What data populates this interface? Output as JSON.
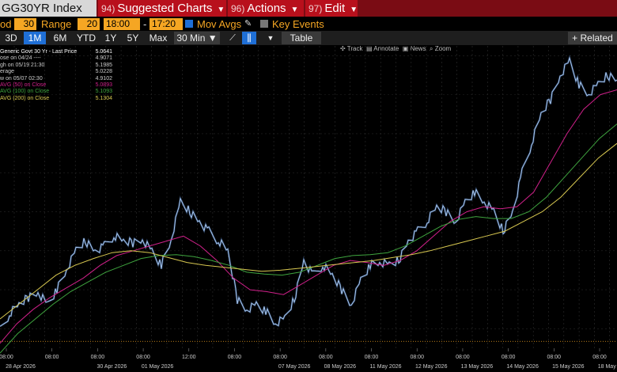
{
  "header": {
    "ticker": "GG30YR Index",
    "menus": [
      {
        "num": "94)",
        "label": "Suggested Charts"
      },
      {
        "num": "96)",
        "label": "Actions"
      },
      {
        "num": "97)",
        "label": "Edit"
      }
    ]
  },
  "settings": {
    "period_label": "od",
    "period_value": "30",
    "range_label": "Range",
    "range_value": "20",
    "time_start": "18:00",
    "time_sep": "-",
    "time_end": "17:20",
    "mov_avgs": "Mov Avgs",
    "key_events": "Key Events"
  },
  "toolbar": {
    "ranges": [
      "3D",
      "1M",
      "6M",
      "YTD",
      "1Y",
      "5Y",
      "Max"
    ],
    "active_range": "1M",
    "interval": "30 Min ▼",
    "table": "Table",
    "related": "+ Related"
  },
  "tools": {
    "track": "Track",
    "annotate": "Annotate",
    "news": "News",
    "zoom": "Zoom"
  },
  "legend": [
    {
      "label": "Generic Govt 30 Yr - Last Price",
      "value": "5.0641",
      "color": "#ffffff"
    },
    {
      "label": "ose on 04/24 ----",
      "value": "4.9071",
      "color": "#cccccc"
    },
    {
      "label": "gh on 05/19 21:30",
      "value": "5.1985",
      "color": "#cccccc"
    },
    {
      "label": "erage",
      "value": "5.0228",
      "color": "#cccccc"
    },
    {
      "label": "w on 05/07 02:30",
      "value": "4.9102",
      "color": "#cccccc"
    },
    {
      "label": "AVG (50)  on Close",
      "value": "5.0893",
      "color": "#d0208a"
    },
    {
      "label": "AVG (100)  on Close",
      "value": "5.1093",
      "color": "#3fa53f"
    },
    {
      "label": "AVG (200)  on Close",
      "value": "5.1304",
      "color": "#d8c850"
    }
  ],
  "colors": {
    "price": "#a8c8f0",
    "ma50": "#d0208a",
    "ma100": "#3fa53f",
    "ma200": "#d8c850",
    "avg_line": "#f5a623",
    "accent": "#1f6fd6",
    "header_bg": "#b8101c"
  },
  "chart_data": {
    "type": "line",
    "ylim": [
      4.9,
      5.21
    ],
    "average": 5.0228,
    "close_ref": 4.9071,
    "x_ticks": [
      {
        "time": "08:00",
        "date": "28 Apr 2026"
      },
      {
        "time": "08:00",
        "date": ""
      },
      {
        "time": "08:00",
        "date": "30 Apr 2026"
      },
      {
        "time": "08:00",
        "date": "01 May 2026"
      },
      {
        "time": "12:00",
        "date": ""
      },
      {
        "time": "08:00",
        "date": ""
      },
      {
        "time": "08:00",
        "date": "07 May 2026"
      },
      {
        "time": "08:00",
        "date": "08 May 2026"
      },
      {
        "time": "08:00",
        "date": "11 May 2026"
      },
      {
        "time": "08:00",
        "date": "12 May 2026"
      },
      {
        "time": "08:00",
        "date": "13 May 2026"
      },
      {
        "time": "08:00",
        "date": "14 May 2026"
      },
      {
        "time": "08:00",
        "date": "15 May 2026"
      },
      {
        "time": "08:00",
        "date": "18 May 2026"
      }
    ],
    "series": [
      {
        "name": "Generic Govt 30 Yr - Last Price",
        "role": "price",
        "values": [
          4.918,
          4.935,
          4.945,
          4.952,
          4.958,
          4.945,
          4.96,
          4.98,
          5.0,
          5.01,
          5.0,
          5.005,
          5.015,
          5.01,
          5.008,
          5.012,
          5.0,
          4.985,
          5.01,
          5.05,
          5.04,
          5.03,
          5.02,
          5.01,
          5.0,
          4.95,
          4.94,
          4.945,
          4.938,
          4.925,
          4.93,
          4.95,
          4.99,
          4.975,
          4.985,
          4.975,
          4.96,
          4.945,
          4.97,
          4.985,
          4.988,
          4.985,
          4.99,
          5.01,
          5.02,
          5.03,
          5.045,
          5.04,
          5.03,
          5.05,
          5.06,
          5.05,
          5.04,
          5.02,
          5.04,
          5.08,
          5.11,
          5.14,
          5.155,
          5.18,
          5.195,
          5.17,
          5.16,
          5.17,
          5.18,
          5.175
        ]
      },
      {
        "name": "AVG (50)  on Close",
        "role": "ma50",
        "values": [
          4.905,
          4.925,
          4.94,
          4.952,
          4.962,
          4.972,
          4.985,
          4.995,
          5.0,
          5.005,
          5.01,
          5.015,
          5.005,
          4.99,
          4.972,
          4.96,
          4.958,
          4.955,
          4.965,
          4.975,
          4.985,
          4.99,
          4.988,
          4.985,
          4.99,
          5.0,
          5.015,
          5.03,
          5.04,
          5.045,
          5.043,
          5.045,
          5.06,
          5.09,
          5.12,
          5.145,
          5.16,
          5.165
        ]
      },
      {
        "name": "AVG (100)  on Close",
        "role": "ma100",
        "values": [
          4.895,
          4.915,
          4.93,
          4.945,
          4.958,
          4.968,
          4.978,
          4.985,
          4.992,
          4.995,
          4.996,
          4.994,
          4.99,
          4.985,
          4.978,
          4.976,
          4.975,
          4.978,
          4.985,
          4.992,
          4.995,
          4.996,
          4.998,
          5.005,
          5.015,
          5.025,
          5.032,
          5.035,
          5.033,
          5.033,
          5.04,
          5.055,
          5.075,
          5.095,
          5.115,
          5.13
        ]
      },
      {
        "name": "AVG (200)  on Close",
        "role": "ma200",
        "values": [
          4.93,
          4.945,
          4.96,
          4.975,
          4.985,
          4.992,
          4.998,
          5.0,
          4.998,
          4.993,
          4.988,
          4.985,
          4.983,
          4.981,
          4.979,
          4.98,
          4.982,
          4.984,
          4.986,
          4.988,
          4.99,
          4.993,
          4.996,
          5.0,
          5.005,
          5.01,
          5.015,
          5.02,
          5.03,
          5.04,
          5.055,
          5.075,
          5.095,
          5.11
        ]
      }
    ]
  }
}
